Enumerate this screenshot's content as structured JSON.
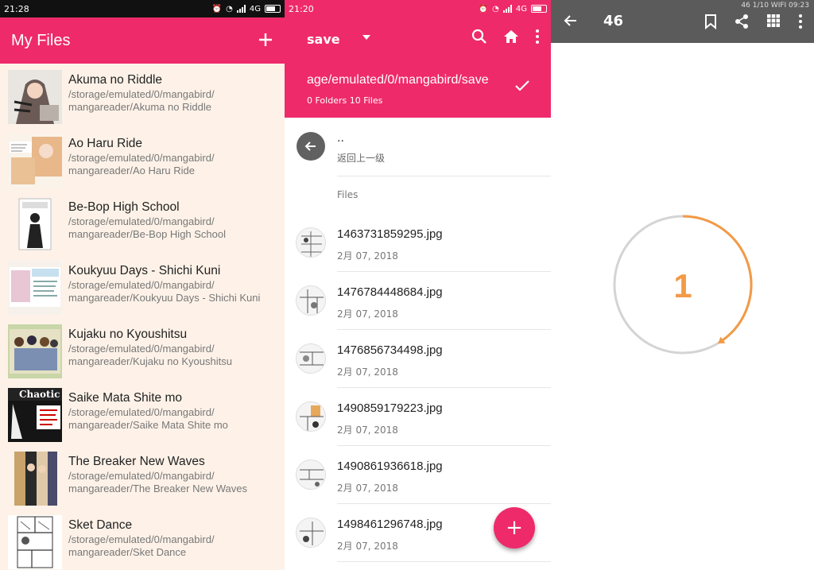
{
  "panel1": {
    "status_time": "21:28",
    "status_network": "4G",
    "title": "My Files",
    "add_icon": "plus-icon",
    "items": [
      {
        "title": "Akuma no Riddle",
        "path1": "/storage/emulated/0/mangabird/",
        "path2": "mangareader/Akuma no Riddle"
      },
      {
        "title": "Ao Haru Ride",
        "path1": "/storage/emulated/0/mangabird/",
        "path2": "mangareader/Ao Haru Ride"
      },
      {
        "title": "Be-Bop High School",
        "path1": "/storage/emulated/0/mangabird/",
        "path2": "mangareader/Be-Bop High School"
      },
      {
        "title": "Koukyuu Days - Shichi Kuni",
        "path1": "/storage/emulated/0/mangabird/",
        "path2": "mangareader/Koukyuu Days - Shichi Kuni"
      },
      {
        "title": "Kujaku no Kyoushitsu",
        "path1": "/storage/emulated/0/mangabird/",
        "path2": "mangareader/Kujaku no Kyoushitsu"
      },
      {
        "title": "Saike Mata Shite mo",
        "path1": "/storage/emulated/0/mangabird/",
        "path2": "mangareader/Saike Mata Shite mo"
      },
      {
        "title": "The Breaker New Waves",
        "path1": "/storage/emulated/0/mangabird/",
        "path2": "mangareader/The Breaker New Waves"
      },
      {
        "title": "Sket Dance",
        "path1": "/storage/emulated/0/mangabird/",
        "path2": "mangareader/Sket Dance"
      }
    ],
    "thumb_label_chaotic": "Chaotic"
  },
  "panel2": {
    "status_time": "21:20",
    "status_network": "4G",
    "dropdown_label": "save",
    "path": "age/emulated/0/mangabird/save",
    "counts": "0 Folders 10 Files",
    "up_dots": "..",
    "up_label": "返回上一级",
    "section": "Files",
    "files": [
      {
        "name": "1463731859295.jpg",
        "date": "2月 07, 2018"
      },
      {
        "name": "1476784448684.jpg",
        "date": "2月 07, 2018"
      },
      {
        "name": "1476856734498.jpg",
        "date": "2月 07, 2018"
      },
      {
        "name": "1490859179223.jpg",
        "date": "2月 07, 2018"
      },
      {
        "name": "1490861936618.jpg",
        "date": "2月 07, 2018"
      },
      {
        "name": "1498461296748.jpg",
        "date": "2月 07, 2018"
      }
    ],
    "fab_label": "+"
  },
  "panel3": {
    "page_number": "46",
    "mini_status": "46  1/10  WIFI 09:23",
    "loading_number": "1",
    "loading_progress": 0.4
  },
  "colors": {
    "accent": "#ee2a6b",
    "list_bg": "#fef2e8",
    "reader_bar": "#5b5b5b",
    "progress": "#f39a46",
    "progress_track": "#d4d4d4"
  }
}
